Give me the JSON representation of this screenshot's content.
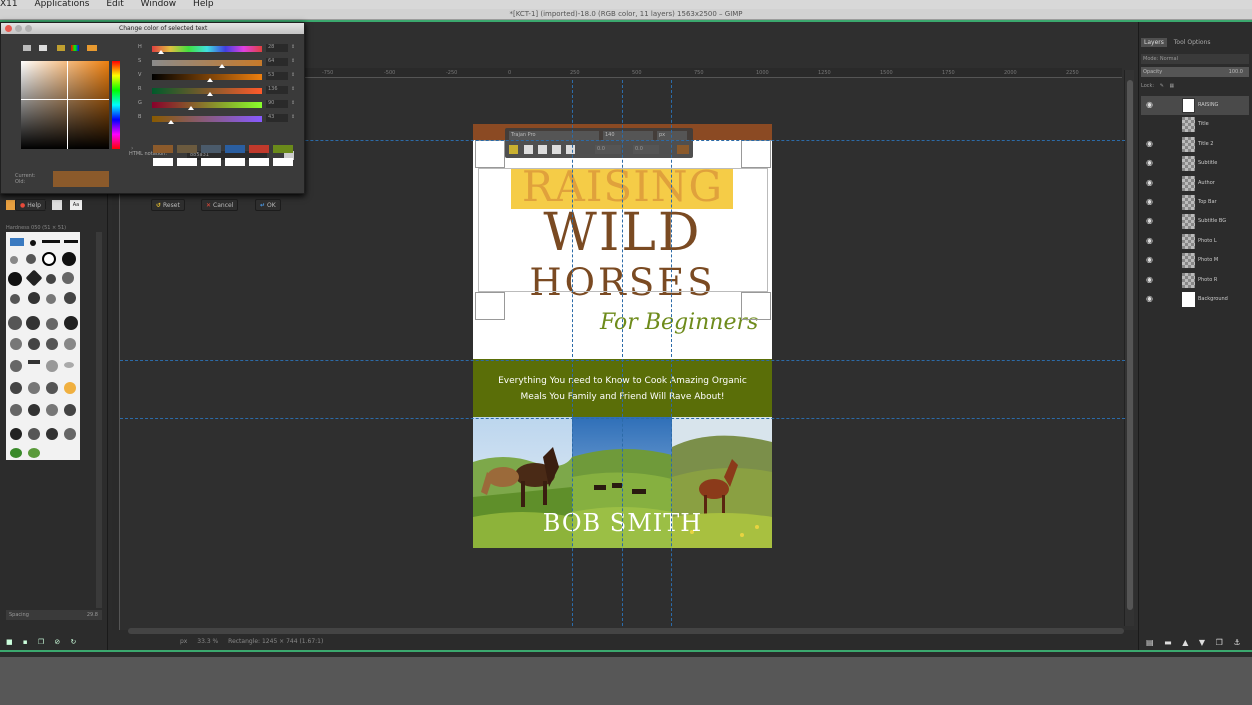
{
  "menubar": {
    "items": [
      "X11",
      "Applications",
      "Edit",
      "Window",
      "Help"
    ]
  },
  "window": {
    "title": "*[KCT-1] (imported)-18.0 (RGB color, 11 layers) 1563x2500 – GIMP"
  },
  "ruler": {
    "ticks": [
      "-750",
      "-500",
      "-250",
      "0",
      "250",
      "500",
      "750",
      "1000",
      "1250",
      "1500",
      "1750",
      "2000",
      "2250"
    ]
  },
  "dialog": {
    "title": "Change color of selected text",
    "channels": [
      {
        "label": "H",
        "value": "28",
        "pos": 0.08,
        "gradient": "linear-gradient(to right,#e04040,#e0c040,#40e040,#40e0e0,#4040e0,#e040e0,#e04040)"
      },
      {
        "label": "S",
        "value": "64",
        "pos": 0.64,
        "gradient": "linear-gradient(to right,#8b8b8b,#c77a2a)"
      },
      {
        "label": "V",
        "value": "53",
        "pos": 0.53,
        "gradient": "linear-gradient(to right,#000,#ed7f0e)"
      },
      {
        "label": "R",
        "value": "136",
        "pos": 0.53,
        "gradient": "linear-gradient(to right,#005a2b,#ff5a2b)"
      },
      {
        "label": "G",
        "value": "90",
        "pos": 0.35,
        "gradient": "linear-gradient(to right,#88002b,#88ff2b)"
      },
      {
        "label": "B",
        "value": "43",
        "pos": 0.17,
        "gradient": "linear-gradient(to right,#885a00,#885aff)"
      }
    ],
    "html_notation_label": "HTML notation:",
    "html_notation_value": "885a31",
    "current_label": "Current:",
    "old_label": "Old:",
    "current_color": "#8B5A2B",
    "history_swatches": [
      "#8B5A2B",
      "#6b5a3e",
      "#4a5a6a",
      "#2a5ea0",
      "#c0392b",
      "#6a8a1a",
      "#ffffff",
      "#ffffff",
      "#ffffff",
      "#ffffff",
      "#ffffff",
      "#ffffff"
    ],
    "buttons": {
      "help": "Help",
      "reset": "Reset",
      "cancel": "Cancel",
      "ok": "OK"
    }
  },
  "toolbox": {
    "brush_label": "Hardness 050 (51 × 51)",
    "spacing_label": "Spacing",
    "spacing_value": "29.8"
  },
  "text_toolbar": {
    "font": "Trajan Pro",
    "size": "140",
    "unit": "px",
    "field_a": "0.0",
    "field_b": "0.0"
  },
  "document": {
    "title_1": "RAISING",
    "title_2": "WILD",
    "title_3": "HORSES",
    "tagline": "For Beginners",
    "subtitle_1": "Everything You need to Know to Cook Amazing Organic",
    "subtitle_2": "Meals You Family and Friend Will Rave About!",
    "author": "BOB SMITH",
    "colors": {
      "top_bar": "#8B4A23",
      "band": "#5a6e08",
      "title_brown": "#7a4a22"
    }
  },
  "statusbar": {
    "unit": "px",
    "zoom": "33.3 %",
    "info": "Rectangle: 1245 × 744  (1.67:1)"
  },
  "layers_panel": {
    "tabs": [
      "Layers",
      "Tool Options"
    ],
    "mode_label": "Mode:",
    "mode_value": "Normal",
    "opacity_label": "Opacity",
    "opacity_value": "100.0",
    "lock_label": "Lock:",
    "layers": [
      {
        "name": "RAISING",
        "visible": true
      },
      {
        "name": "Title",
        "visible": false
      },
      {
        "name": "Title 2",
        "visible": true
      },
      {
        "name": "Subtitle",
        "visible": true
      },
      {
        "name": "Author",
        "visible": true
      },
      {
        "name": "Top Bar",
        "visible": true
      },
      {
        "name": "Subtitle BG",
        "visible": true
      },
      {
        "name": "Photo L",
        "visible": true
      },
      {
        "name": "Photo M",
        "visible": true
      },
      {
        "name": "Photo R",
        "visible": true
      },
      {
        "name": "Background",
        "visible": true
      }
    ]
  }
}
